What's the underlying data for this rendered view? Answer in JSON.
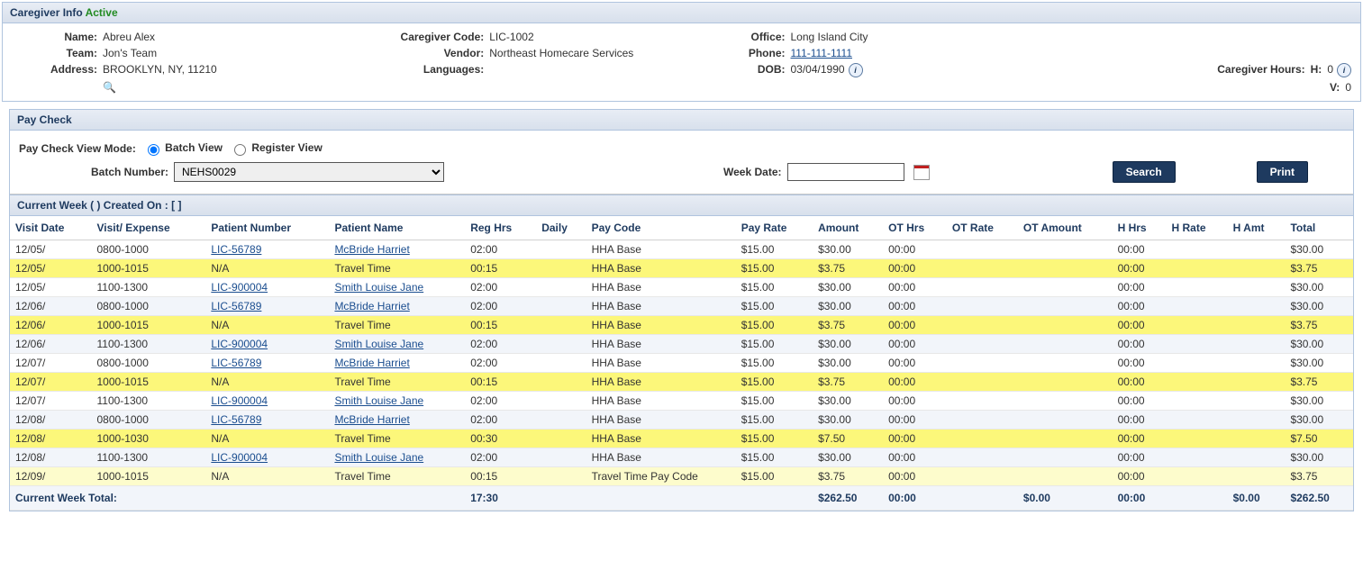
{
  "header": {
    "title": "Caregiver Info",
    "status": "Active",
    "fields": {
      "name_lbl": "Name:",
      "name_val": "Abreu Alex",
      "team_lbl": "Team:",
      "team_val": "Jon's Team",
      "address_lbl": "Address:",
      "address_val": "BROOKLYN, NY, 11210",
      "code_lbl": "Caregiver Code:",
      "code_val": "LIC-1002",
      "vendor_lbl": "Vendor:",
      "vendor_val": "Northeast Homecare Services",
      "lang_lbl": "Languages:",
      "lang_val": "",
      "office_lbl": "Office:",
      "office_val": "Long Island City",
      "phone_lbl": "Phone:",
      "phone_val": "111-111-1111",
      "dob_lbl": "DOB:",
      "dob_val": "03/04/1990",
      "hours_lbl": "Caregiver Hours:",
      "hours_h_lbl": "H:",
      "hours_h_val": "0",
      "hours_v_lbl": "V:",
      "hours_v_val": "0"
    }
  },
  "paycheck": {
    "title": "Pay Check",
    "mode_lbl": "Pay Check View Mode:",
    "batch_view_lbl": "Batch View",
    "register_view_lbl": "Register View",
    "batch_number_lbl": "Batch Number:",
    "batch_number_val": "NEHS0029",
    "week_date_lbl": "Week Date:",
    "week_date_val": "",
    "search_btn": "Search",
    "print_btn": "Print"
  },
  "week": {
    "heading": "Current Week (                                                  ) Created On : [                                        ]",
    "columns": [
      "Visit Date",
      "Visit/ Expense",
      "Patient Number",
      "Patient Name",
      "Reg Hrs",
      "Daily",
      "Pay Code",
      "Pay Rate",
      "Amount",
      "OT Hrs",
      "OT Rate",
      "OT Amount",
      "H Hrs",
      "H Rate",
      "H Amt",
      "Total"
    ],
    "rows": [
      {
        "hl": "",
        "d": [
          "12/05/",
          "0800-1000",
          "LIC-56789",
          "McBride Harriet",
          "02:00",
          "",
          "HHA Base",
          "$15.00",
          "$30.00",
          "00:00",
          "",
          "",
          "00:00",
          "",
          "",
          "$30.00"
        ]
      },
      {
        "hl": "y",
        "d": [
          "12/05/",
          "1000-1015",
          "N/A",
          "Travel Time",
          "00:15",
          "",
          "HHA Base",
          "$15.00",
          "$3.75",
          "00:00",
          "",
          "",
          "00:00",
          "",
          "",
          "$3.75"
        ]
      },
      {
        "hl": "",
        "d": [
          "12/05/",
          "1100-1300",
          "LIC-900004",
          "Smith Louise Jane",
          "02:00",
          "",
          "HHA Base",
          "$15.00",
          "$30.00",
          "00:00",
          "",
          "",
          "00:00",
          "",
          "",
          "$30.00"
        ]
      },
      {
        "hl": "",
        "d": [
          "12/06/",
          "0800-1000",
          "LIC-56789",
          "McBride Harriet",
          "02:00",
          "",
          "HHA Base",
          "$15.00",
          "$30.00",
          "00:00",
          "",
          "",
          "00:00",
          "",
          "",
          "$30.00"
        ]
      },
      {
        "hl": "y",
        "d": [
          "12/06/",
          "1000-1015",
          "N/A",
          "Travel Time",
          "00:15",
          "",
          "HHA Base",
          "$15.00",
          "$3.75",
          "00:00",
          "",
          "",
          "00:00",
          "",
          "",
          "$3.75"
        ]
      },
      {
        "hl": "",
        "d": [
          "12/06/",
          "1100-1300",
          "LIC-900004",
          "Smith Louise Jane",
          "02:00",
          "",
          "HHA Base",
          "$15.00",
          "$30.00",
          "00:00",
          "",
          "",
          "00:00",
          "",
          "",
          "$30.00"
        ]
      },
      {
        "hl": "",
        "d": [
          "12/07/",
          "0800-1000",
          "LIC-56789",
          "McBride Harriet",
          "02:00",
          "",
          "HHA Base",
          "$15.00",
          "$30.00",
          "00:00",
          "",
          "",
          "00:00",
          "",
          "",
          "$30.00"
        ]
      },
      {
        "hl": "y",
        "d": [
          "12/07/",
          "1000-1015",
          "N/A",
          "Travel Time",
          "00:15",
          "",
          "HHA Base",
          "$15.00",
          "$3.75",
          "00:00",
          "",
          "",
          "00:00",
          "",
          "",
          "$3.75"
        ]
      },
      {
        "hl": "",
        "d": [
          "12/07/",
          "1100-1300",
          "LIC-900004",
          "Smith Louise Jane",
          "02:00",
          "",
          "HHA Base",
          "$15.00",
          "$30.00",
          "00:00",
          "",
          "",
          "00:00",
          "",
          "",
          "$30.00"
        ]
      },
      {
        "hl": "",
        "d": [
          "12/08/",
          "0800-1000",
          "LIC-56789",
          "McBride Harriet",
          "02:00",
          "",
          "HHA Base",
          "$15.00",
          "$30.00",
          "00:00",
          "",
          "",
          "00:00",
          "",
          "",
          "$30.00"
        ]
      },
      {
        "hl": "y",
        "d": [
          "12/08/",
          "1000-1030",
          "N/A",
          "Travel Time",
          "00:30",
          "",
          "HHA Base",
          "$15.00",
          "$7.50",
          "00:00",
          "",
          "",
          "00:00",
          "",
          "",
          "$7.50"
        ]
      },
      {
        "hl": "",
        "d": [
          "12/08/",
          "1100-1300",
          "LIC-900004",
          "Smith Louise Jane",
          "02:00",
          "",
          "HHA Base",
          "$15.00",
          "$30.00",
          "00:00",
          "",
          "",
          "00:00",
          "",
          "",
          "$30.00"
        ]
      },
      {
        "hl": "y2",
        "d": [
          "12/09/",
          "1000-1015",
          "N/A",
          "Travel Time",
          "00:15",
          "",
          "Travel Time Pay Code",
          "$15.00",
          "$3.75",
          "00:00",
          "",
          "",
          "00:00",
          "",
          "",
          "$3.75"
        ]
      }
    ],
    "totals": {
      "label": "Current Week Total:",
      "reg_hrs": "17:30",
      "amount": "$262.50",
      "ot_hrs": "00:00",
      "ot_amount": "$0.00",
      "h_hrs": "00:00",
      "h_amt": "$0.00",
      "total": "$262.50"
    }
  }
}
